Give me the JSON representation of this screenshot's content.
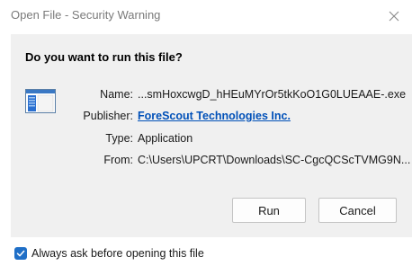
{
  "window": {
    "title": "Open File - Security Warning",
    "close_icon": "close-icon"
  },
  "prompt": {
    "question": "Do you want to run this file?",
    "file_icon": "executable-file-icon"
  },
  "details": {
    "name_label": "Name:",
    "name_value": "...smHoxcwgD_hHEuMYrOr5tkKoO1G0LUEAAE-.exe",
    "publisher_label": "Publisher:",
    "publisher_value": "ForeScout Technologies Inc.",
    "type_label": "Type:",
    "type_value": "Application",
    "from_label": "From:",
    "from_value": "C:\\Users\\UPCRT\\Downloads\\SC-CgcQCScTVMG9N..."
  },
  "buttons": {
    "run_label": "Run",
    "cancel_label": "Cancel"
  },
  "footer": {
    "checkbox_checked": true,
    "checkbox_label": "Always ask before opening this file"
  },
  "colors": {
    "accent": "#1f6fc7",
    "link": "#0050b8",
    "panel_bg": "#f0f0f0"
  }
}
